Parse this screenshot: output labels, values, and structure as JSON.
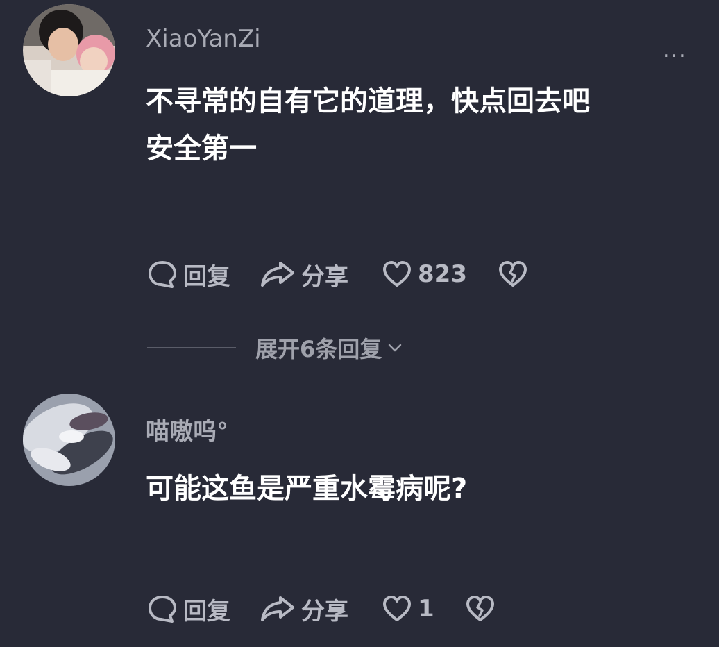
{
  "comments": [
    {
      "username": "XiaoYanZi",
      "more_label": "...",
      "text_line1": "不寻常的自有它的道理，快点回去吧",
      "text_line2": "安全第一",
      "reply_label": "回复",
      "share_label": "分享",
      "like_count": "823"
    },
    {
      "username": "喵嗷呜°",
      "text_line1": "可能这鱼是严重水霉病呢?",
      "reply_label": "回复",
      "share_label": "分享",
      "like_count": "1"
    }
  ],
  "expand_replies_label": "展开6条回复",
  "colors": {
    "background": "#282a37",
    "username": "#a9abb5",
    "action": "#b8bac4"
  },
  "icons": [
    "comment-bubble-icon",
    "share-arrow-icon",
    "heart-icon",
    "broken-heart-icon",
    "chevron-down-icon",
    "more-icon"
  ]
}
